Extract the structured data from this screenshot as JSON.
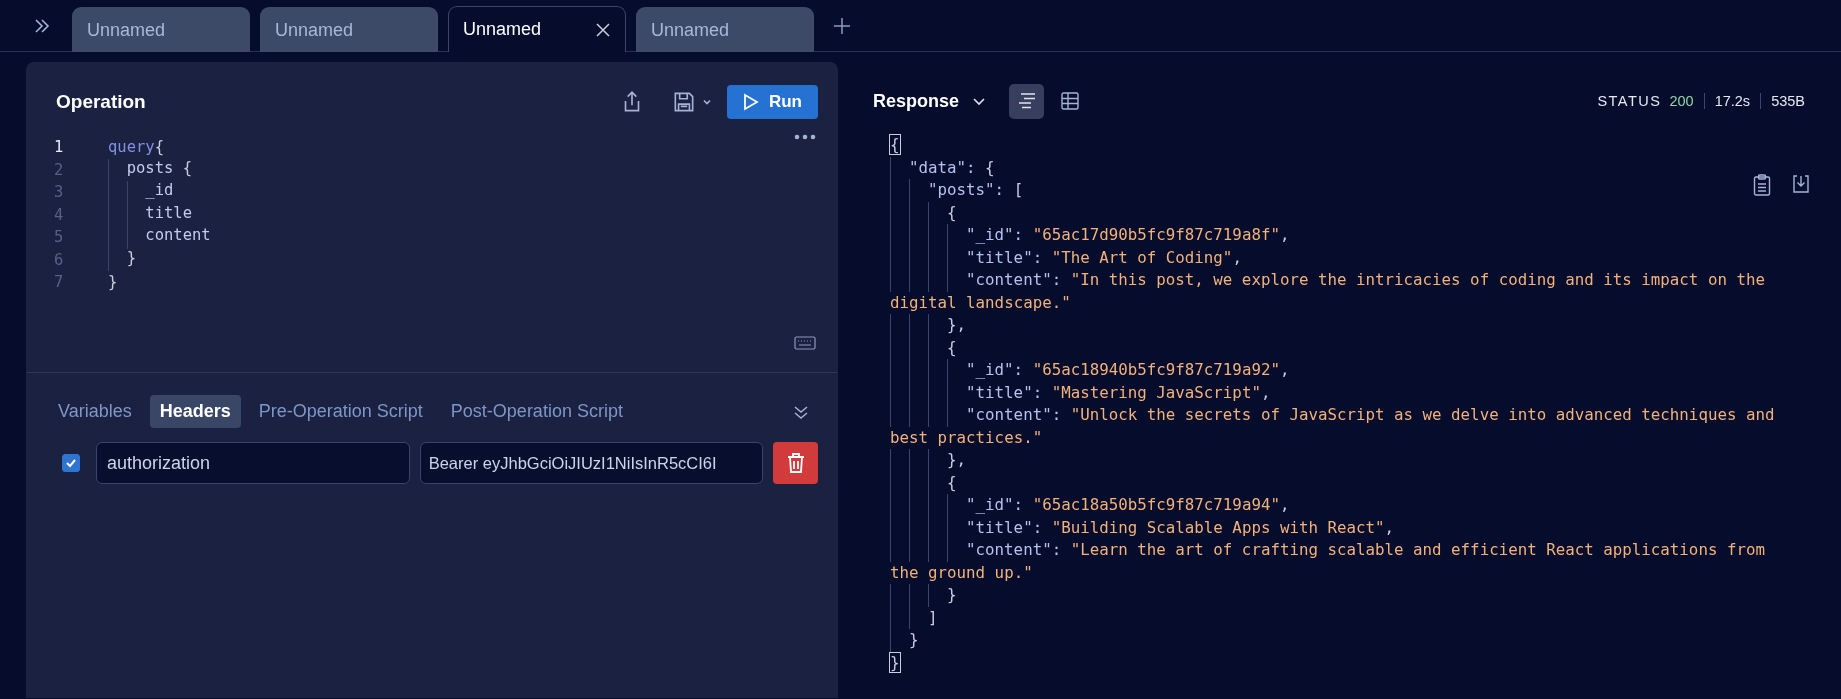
{
  "tabs": [
    {
      "label": "Unnamed",
      "selected": false
    },
    {
      "label": "Unnamed",
      "selected": false
    },
    {
      "label": "Unnamed",
      "selected": true
    },
    {
      "label": "Unnamed",
      "selected": false
    }
  ],
  "operation": {
    "title": "Operation",
    "run_label": "Run",
    "lines": [
      {
        "number": "1",
        "current": true,
        "tokens": [
          {
            "kind": "keyword",
            "text": "query"
          },
          {
            "kind": "punct",
            "text": "{"
          }
        ],
        "children": [
          {
            "number": "2",
            "current": false,
            "tokens": [
              {
                "kind": "field",
                "text": "posts"
              },
              {
                "kind": "punct",
                "text": " {"
              }
            ],
            "children": [
              {
                "number": "3",
                "current": false,
                "tokens": [
                  {
                    "kind": "field",
                    "text": "_id"
                  }
                ]
              },
              {
                "number": "4",
                "current": false,
                "tokens": [
                  {
                    "kind": "field",
                    "text": "title"
                  }
                ]
              },
              {
                "number": "5",
                "current": false,
                "tokens": [
                  {
                    "kind": "field",
                    "text": "content"
                  }
                ]
              }
            ]
          },
          {
            "number": "6",
            "current": false,
            "tokens": [
              {
                "kind": "punct",
                "text": "}"
              }
            ]
          }
        ]
      },
      {
        "number": "7",
        "current": false,
        "tokens": [
          {
            "kind": "punct",
            "text": "}"
          }
        ]
      }
    ]
  },
  "request_tabs": [
    {
      "label": "Variables",
      "selected": false
    },
    {
      "label": "Headers",
      "selected": true
    },
    {
      "label": "Pre-Operation Script",
      "selected": false
    },
    {
      "label": "Post-Operation Script",
      "selected": false
    }
  ],
  "headers": [
    {
      "checked": true,
      "key": "authorization",
      "value": "Bearer eyJhbGciOiJIUzI1NiIsInR5cCI6I"
    }
  ],
  "response": {
    "title": "Response",
    "views": [
      {
        "kind": "list",
        "selected": true
      },
      {
        "kind": "table",
        "selected": false
      }
    ],
    "status_label": "STATUS",
    "status": "200",
    "time": "17.2s",
    "size": "535B",
    "lines": [
      {
        "bracket_match": true,
        "tokens": [
          {
            "kind": "punct",
            "text": "{"
          }
        ],
        "children": [
          {
            "tokens": [
              {
                "kind": "key",
                "text": "\"data\":"
              },
              {
                "kind": "punct",
                "text": " {"
              }
            ],
            "children": [
              {
                "tokens": [
                  {
                    "kind": "key",
                    "text": "\"posts\":"
                  },
                  {
                    "kind": "punct",
                    "text": " ["
                  }
                ],
                "children": [
                  {
                    "tokens": [
                      {
                        "kind": "punct",
                        "text": "{"
                      }
                    ],
                    "children": [
                      {
                        "tokens": [
                          {
                            "kind": "key",
                            "text": "\"_id\":"
                          },
                          {
                            "kind": "string",
                            "text": " \"65ac17d90b5fc9f87c719a8f\""
                          },
                          {
                            "kind": "punct",
                            "text": ","
                          }
                        ]
                      },
                      {
                        "tokens": [
                          {
                            "kind": "key",
                            "text": "\"title\":"
                          },
                          {
                            "kind": "string",
                            "text": " \"The Art of Coding\""
                          },
                          {
                            "kind": "punct",
                            "text": ","
                          }
                        ]
                      },
                      {
                        "tokens": [
                          {
                            "kind": "key",
                            "text": "\"content\":"
                          },
                          {
                            "kind": "string",
                            "text": " \"In this post, we explore the intricacies of coding and its impact on the digital landscape.\""
                          }
                        ]
                      }
                    ]
                  },
                  {
                    "tokens": [
                      {
                        "kind": "punct",
                        "text": "},"
                      }
                    ]
                  },
                  {
                    "tokens": [
                      {
                        "kind": "punct",
                        "text": "{"
                      }
                    ],
                    "children": [
                      {
                        "tokens": [
                          {
                            "kind": "key",
                            "text": "\"_id\":"
                          },
                          {
                            "kind": "string",
                            "text": " \"65ac18940b5fc9f87c719a92\""
                          },
                          {
                            "kind": "punct",
                            "text": ","
                          }
                        ]
                      },
                      {
                        "tokens": [
                          {
                            "kind": "key",
                            "text": "\"title\":"
                          },
                          {
                            "kind": "string",
                            "text": " \"Mastering JavaScript\""
                          },
                          {
                            "kind": "punct",
                            "text": ","
                          }
                        ]
                      },
                      {
                        "tokens": [
                          {
                            "kind": "key",
                            "text": "\"content\":"
                          },
                          {
                            "kind": "string",
                            "text": " \"Unlock the secrets of JavaScript as we delve into advanced techniques and best practices.\""
                          }
                        ]
                      }
                    ]
                  },
                  {
                    "tokens": [
                      {
                        "kind": "punct",
                        "text": "},"
                      }
                    ]
                  },
                  {
                    "tokens": [
                      {
                        "kind": "punct",
                        "text": "{"
                      }
                    ],
                    "children": [
                      {
                        "tokens": [
                          {
                            "kind": "key",
                            "text": "\"_id\":"
                          },
                          {
                            "kind": "string",
                            "text": " \"65ac18a50b5fc9f87c719a94\""
                          },
                          {
                            "kind": "punct",
                            "text": ","
                          }
                        ]
                      },
                      {
                        "tokens": [
                          {
                            "kind": "key",
                            "text": "\"title\":"
                          },
                          {
                            "kind": "string",
                            "text": " \"Building Scalable Apps with React\""
                          },
                          {
                            "kind": "punct",
                            "text": ","
                          }
                        ]
                      },
                      {
                        "tokens": [
                          {
                            "kind": "key",
                            "text": "\"content\":"
                          },
                          {
                            "kind": "string",
                            "text": " \"Learn the art of crafting scalable and efficient React applications from the ground up.\""
                          }
                        ]
                      }
                    ]
                  },
                  {
                    "tokens": [
                      {
                        "kind": "punct",
                        "text": "}"
                      }
                    ]
                  }
                ]
              },
              {
                "tokens": [
                  {
                    "kind": "punct",
                    "text": "]"
                  }
                ]
              }
            ]
          },
          {
            "tokens": [
              {
                "kind": "punct",
                "text": "}"
              }
            ]
          }
        ]
      },
      {
        "bracket_match": true,
        "tokens": [
          {
            "kind": "punct",
            "text": "}"
          }
        ]
      }
    ]
  }
}
